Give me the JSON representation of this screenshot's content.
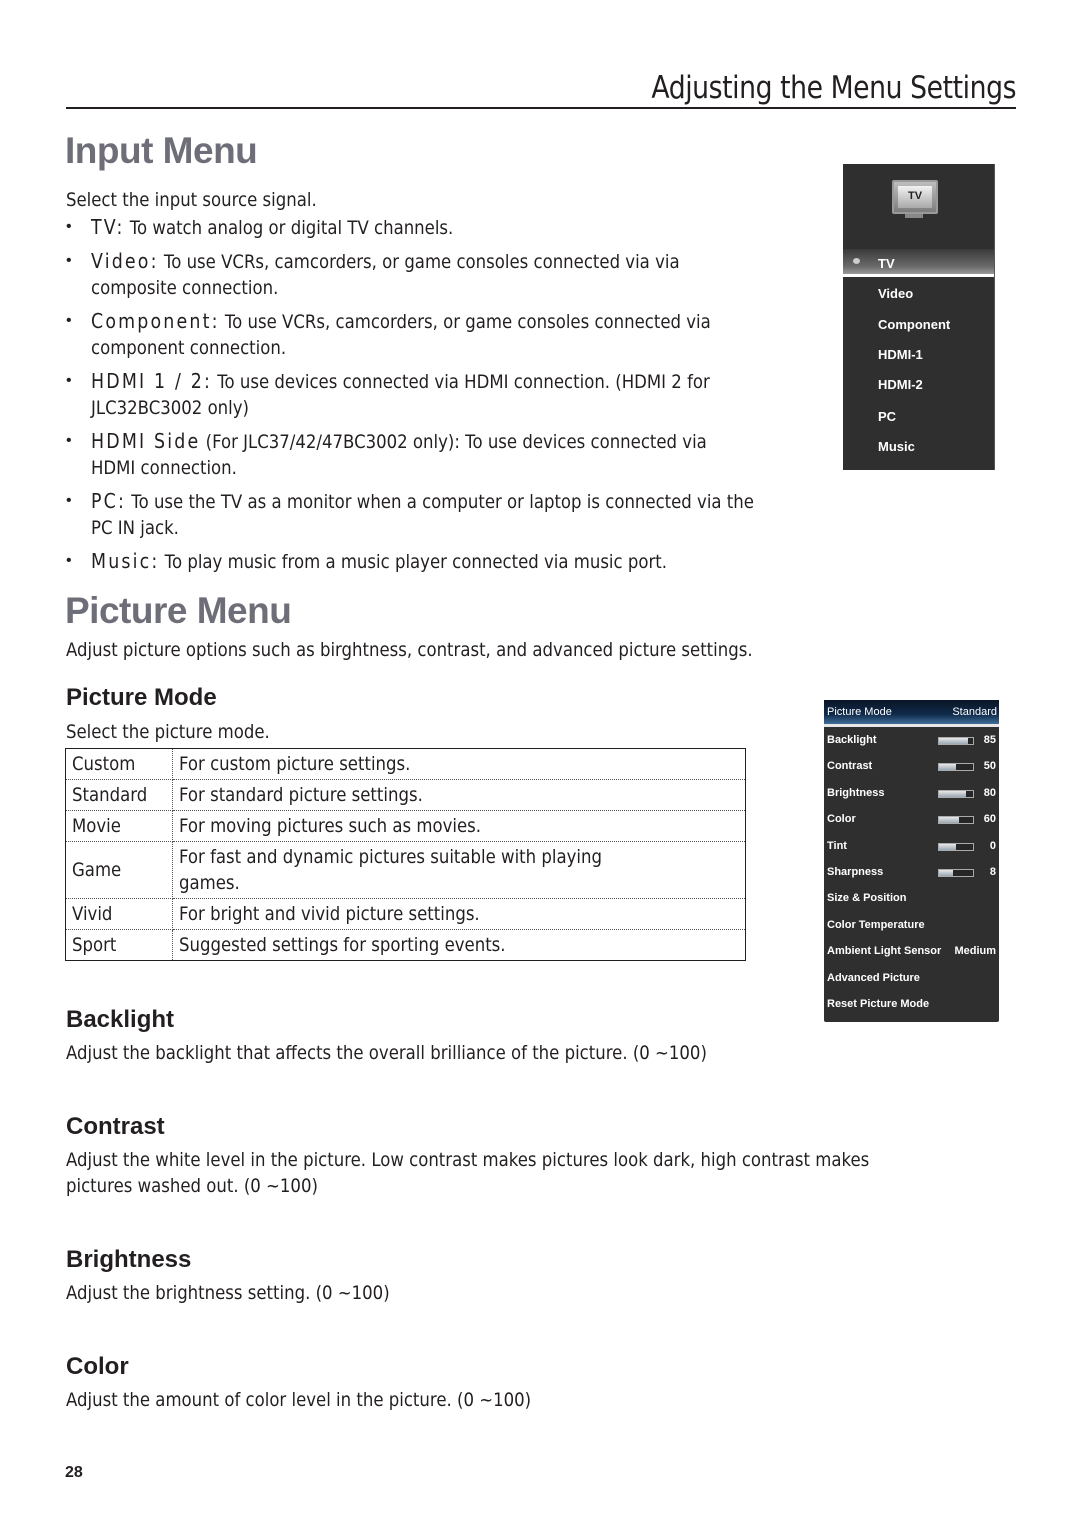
{
  "header": {
    "running_title": "Adjusting the Menu Settings"
  },
  "input_menu": {
    "title": "Input Menu",
    "intro": "Select the input source signal.",
    "items": [
      {
        "term": "TV:",
        "desc": " To watch analog or digital TV channels.",
        "desc2": ""
      },
      {
        "term": "Video:",
        "desc": " To use VCRs, camcorders, or game consoles connected via via",
        "desc2": "composite connection."
      },
      {
        "term": "Component:",
        "desc": " To use VCRs, camcorders, or game consoles connected via",
        "desc2": "component connection."
      },
      {
        "term": "HDMI 1 / 2:",
        "desc": " To use devices connected via HDMI connection. (HDMI 2 for",
        "desc2": "JLC32BC3002 only)"
      },
      {
        "term": "HDMI Side",
        "desc": " (For JLC37/42/47BC3002 only): To use devices connected via",
        "desc2": "HDMI connection."
      },
      {
        "term": "PC:",
        "desc": " To use the TV as a monitor when a computer or laptop is connected via the",
        "desc2": "PC IN jack."
      },
      {
        "term": "Music:",
        "desc": " To play music from a music player connected via music port.",
        "desc2": ""
      }
    ],
    "osd": {
      "icon": "tv-icon",
      "icon_label": "TV",
      "selected": "TV",
      "options": [
        "TV",
        "Video",
        "Component",
        "HDMI-1",
        "HDMI-2",
        "PC",
        "Music"
      ]
    }
  },
  "picture_menu": {
    "title": "Picture Menu",
    "intro": "Adjust picture options such as birghtness, contrast, and advanced picture settings.",
    "picture_mode": {
      "heading": "Picture Mode",
      "intro": "Select the picture mode.",
      "table": [
        {
          "mode": "Custom",
          "desc": "For custom picture settings."
        },
        {
          "mode": "Standard",
          "desc": "For standard picture settings."
        },
        {
          "mode": "Movie",
          "desc": "For moving pictures such as movies."
        },
        {
          "mode": "Game",
          "desc": "For fast and dynamic pictures suitable with playing games."
        },
        {
          "mode": "Vivid",
          "desc": "For bright and vivid picture settings."
        },
        {
          "mode": "Sport",
          "desc": "Suggested settings for sporting events."
        }
      ]
    },
    "osd": {
      "header_label": "Picture Mode",
      "header_value": "Standard",
      "header_color": "#0f2a4a",
      "rows": [
        {
          "label": "Backlight",
          "value": "85",
          "level": 0.85
        },
        {
          "label": "Contrast",
          "value": "50",
          "level": 0.5
        },
        {
          "label": "Brightness",
          "value": "80",
          "level": 0.8
        },
        {
          "label": "Color",
          "value": "60",
          "level": 0.6
        },
        {
          "label": "Tint",
          "value": "0",
          "level": 0.5
        },
        {
          "label": "Sharpness",
          "value": "8",
          "level": 0.4
        },
        {
          "label": "Size & Position",
          "value": ""
        },
        {
          "label": "Color Temperature",
          "value": ""
        },
        {
          "label": "Ambient Light Sensor",
          "value": "Medium"
        },
        {
          "label": "Advanced Picture",
          "value": ""
        },
        {
          "label": "Reset Picture Mode",
          "value": ""
        }
      ]
    },
    "sections": [
      {
        "heading": "Backlight",
        "lines": [
          "Adjust the backlight that affects the overall brilliance of the picture. (0 ~100)"
        ]
      },
      {
        "heading": "Contrast",
        "lines": [
          "Adjust the white level in the picture. Low contrast makes pictures look dark, high contrast makes",
          "pictures washed out. (0 ~100)"
        ]
      },
      {
        "heading": "Brightness",
        "lines": [
          "Adjust the brightness setting. (0 ~100)"
        ]
      },
      {
        "heading": "Color",
        "lines": [
          "Adjust the amount of color level in the picture. (0 ~100)"
        ]
      }
    ]
  },
  "footer": {
    "page_number": "28"
  }
}
